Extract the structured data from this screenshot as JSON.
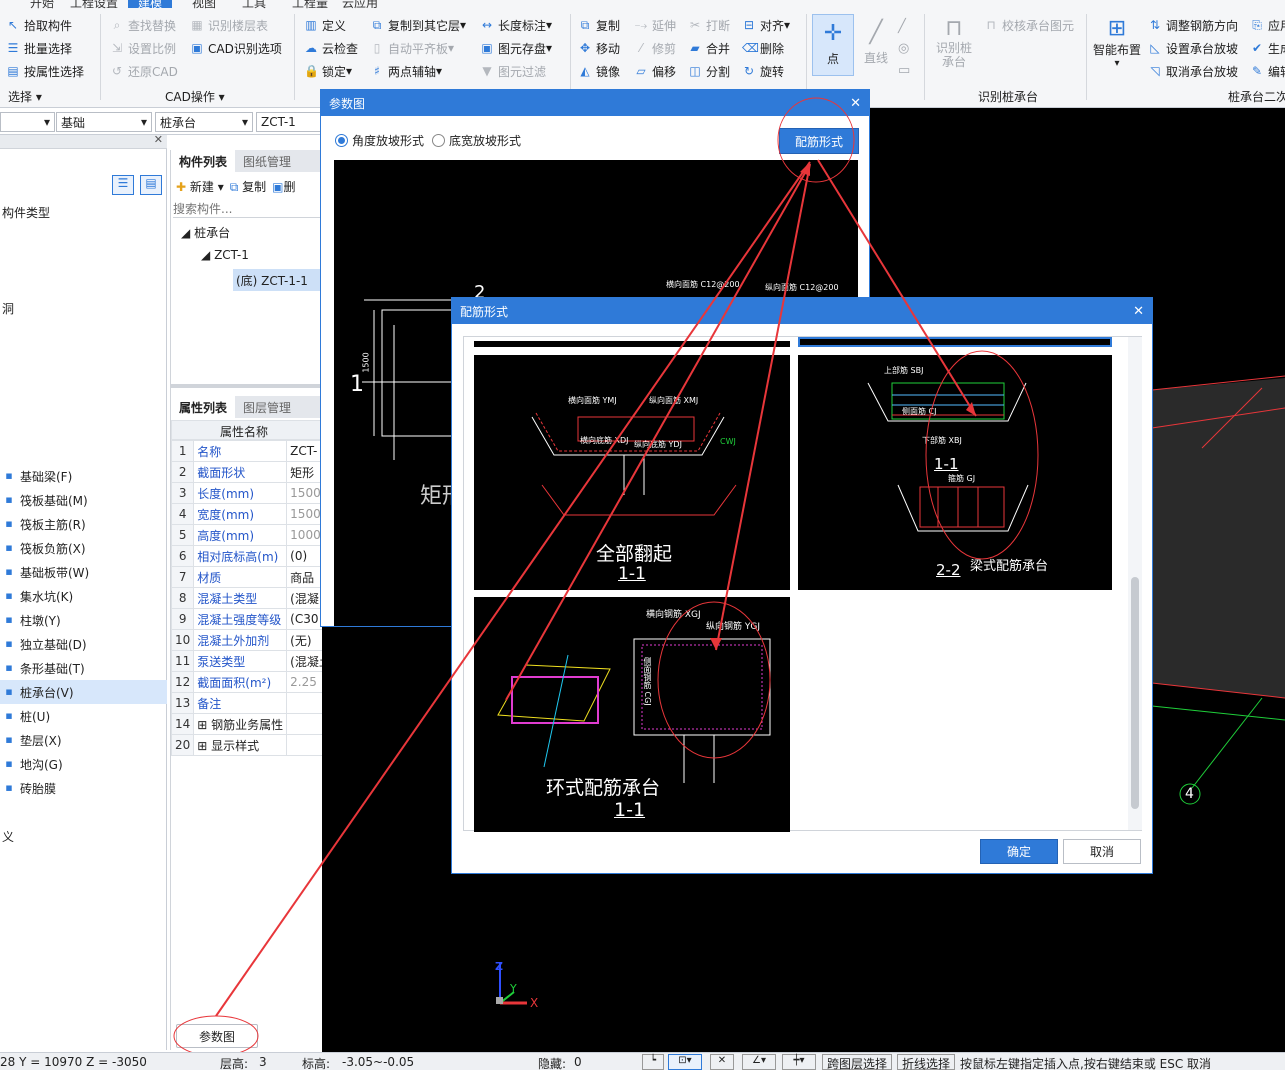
{
  "menubar": {
    "tabs": [
      "开始",
      "工程设置",
      "建模",
      "视图",
      "工具",
      "工程量",
      "云应用"
    ]
  },
  "ribbon": {
    "select": {
      "pick": "拾取构件",
      "batch": "批量选择",
      "byprop": "按属性选择",
      "group": "选择"
    },
    "cad": {
      "find": "查找替换",
      "ratio": "设置比例",
      "restore": "还原CAD",
      "layer": "识别楼层表",
      "cadopt": "CAD识别选项",
      "group": "CAD操作"
    },
    "general": {
      "define": "定义",
      "cloud": "云检查",
      "lock": "锁定",
      "copyto": "复制到其它层",
      "autoalign": "自动平齐板",
      "twopoint": "两点辅轴",
      "dimlen": "长度标注",
      "save": "图元存盘",
      "filter": "图元过滤"
    },
    "modify": {
      "copy": "复制",
      "move": "移动",
      "mirror": "镜像",
      "extend": "延伸",
      "trim": "修剪",
      "offset": "偏移",
      "break": "打断",
      "merge": "合并",
      "split": "分割",
      "align": "对齐",
      "delete": "删除",
      "rotate": "旋转"
    },
    "draw": {
      "point": "点",
      "line": "直线"
    },
    "recog": {
      "rec": "识别桩承台",
      "verify": "校核承台图元",
      "group": "识别桩承台"
    },
    "pile": {
      "smart": "智能布置",
      "adjust": "调整钢筋方向",
      "setslope": "设置承台放坡",
      "cancelslope": "取消承台放坡",
      "app": "应用",
      "gen": "生成",
      "edit": "编辑",
      "group": "桩承台二次编辑"
    }
  },
  "filter": {
    "c1": "",
    "c2": "基础",
    "c3": "桩承台",
    "c4": "ZCT-1"
  },
  "leftnav": {
    "items": [
      {
        "label": "构件类型",
        "icon": ""
      },
      {
        "label": "",
        "icon": ""
      },
      {
        "label": "洞",
        "icon": ""
      },
      {
        "label": "基础梁(F)",
        "icon": "beam-icon"
      },
      {
        "label": "筏板基础(M)",
        "icon": "raft-icon"
      },
      {
        "label": "筏板主筋(R)",
        "icon": "rebar-icon"
      },
      {
        "label": "筏板负筋(X)",
        "icon": "rebar-icon"
      },
      {
        "label": "基础板带(W)",
        "icon": "strip-icon"
      },
      {
        "label": "集水坑(K)",
        "icon": "pit-icon"
      },
      {
        "label": "柱墩(Y)",
        "icon": "pier-icon"
      },
      {
        "label": "独立基础(D)",
        "icon": "footing-icon"
      },
      {
        "label": "条形基础(T)",
        "icon": "strip-footing-icon"
      },
      {
        "label": "桩承台(V)",
        "icon": "pilecap-icon"
      },
      {
        "label": "桩(U)",
        "icon": "pile-icon"
      },
      {
        "label": "垫层(X)",
        "icon": "cushion-icon"
      },
      {
        "label": "地沟(G)",
        "icon": "trench-icon"
      },
      {
        "label": "砖胎膜",
        "icon": "brick-icon"
      },
      {
        "label": "义",
        "icon": ""
      }
    ]
  },
  "components": {
    "tab1": "构件列表",
    "tab2": "图纸管理",
    "new": "新建",
    "copy": "复制",
    "del": "删",
    "search_placeholder": "搜索构件...",
    "tree": {
      "root": "桩承台",
      "child": "ZCT-1",
      "leaf": "(底) ZCT-1-1"
    }
  },
  "props": {
    "tab1": "属性列表",
    "tab2": "图层管理",
    "header": "属性名称",
    "rows": [
      {
        "n": "1",
        "name": "名称",
        "val": "ZCT-"
      },
      {
        "n": "2",
        "name": "截面形状",
        "val": "矩形"
      },
      {
        "n": "3",
        "name": "长度(mm)",
        "val": "1500"
      },
      {
        "n": "4",
        "name": "宽度(mm)",
        "val": "1500"
      },
      {
        "n": "5",
        "name": "高度(mm)",
        "val": "1000"
      },
      {
        "n": "6",
        "name": "相对底标高(m)",
        "val": "(0)"
      },
      {
        "n": "7",
        "name": "材质",
        "val": "商品"
      },
      {
        "n": "8",
        "name": "混凝土类型",
        "val": "(混凝"
      },
      {
        "n": "9",
        "name": "混凝土强度等级",
        "val": "(C30"
      },
      {
        "n": "10",
        "name": "混凝土外加剂",
        "val": "(无)"
      },
      {
        "n": "11",
        "name": "泵送类型",
        "val": "(混凝土泵)"
      },
      {
        "n": "12",
        "name": "截面面积(m²)",
        "val": "2.25"
      },
      {
        "n": "13",
        "name": "备注",
        "val": ""
      },
      {
        "n": "14",
        "name": "钢筋业务属性",
        "val": ""
      },
      {
        "n": "20",
        "name": "显示样式",
        "val": ""
      }
    ],
    "param_button": "参数图"
  },
  "dlg_param": {
    "title": "参数图",
    "radio1": "角度放坡形式",
    "radio2": "底宽放坡形式",
    "btn": "配筋形式",
    "cad": {
      "num2": "2",
      "num1": "1",
      "dim": "1500",
      "shape": "矩形",
      "lbl1": "横向面筋 C12@200",
      "lbl2": "纵向面筋 C12@200"
    }
  },
  "dlg_rebar": {
    "title": "配筋形式",
    "ok": "确定",
    "cancel": "取消",
    "tile1": {
      "title": "全部翻起",
      "sec": "1-1",
      "l1": "横向面筋 YMJ",
      "l2": "纵向面筋 XMJ",
      "l3": "横向底筋 XDJ",
      "l4": "纵向底筋 YDJ",
      "l5": "CWJ"
    },
    "tile2": {
      "title": "梁式配筋承台",
      "sec1": "1-1",
      "sec2": "2-2",
      "l1": "上部筋 SBJ",
      "l2": "侧面筋 CJ",
      "l3": "下部筋 XBJ",
      "l4": "箍筋 GJ"
    },
    "tile3": {
      "title": "环式配筋承台",
      "sec": "1-1",
      "l1": "横向钢筋 XGJ",
      "l2": "纵向钢筋 YGJ",
      "l3": "侧面钢筋 CGJ"
    }
  },
  "canvas": {
    "axis_label": "4",
    "z": "Z",
    "y": "Y",
    "x": "X"
  },
  "status": {
    "coords": "28 Y = 10970 Z = -3050",
    "floor_label": "层高:",
    "floor_val": "3",
    "elev_label": "标高:",
    "elev_val": "-3.05~-0.05",
    "hidden_label": "隐藏:",
    "hidden_val": "0",
    "layer_sel": "跨图层选择",
    "polyline_sel": "折线选择",
    "hint": "按鼠标左键指定插入点,按右键结束或 ESC 取消"
  },
  "colors": {
    "accent": "#2f7ad8",
    "annotation": "#e8363a"
  }
}
